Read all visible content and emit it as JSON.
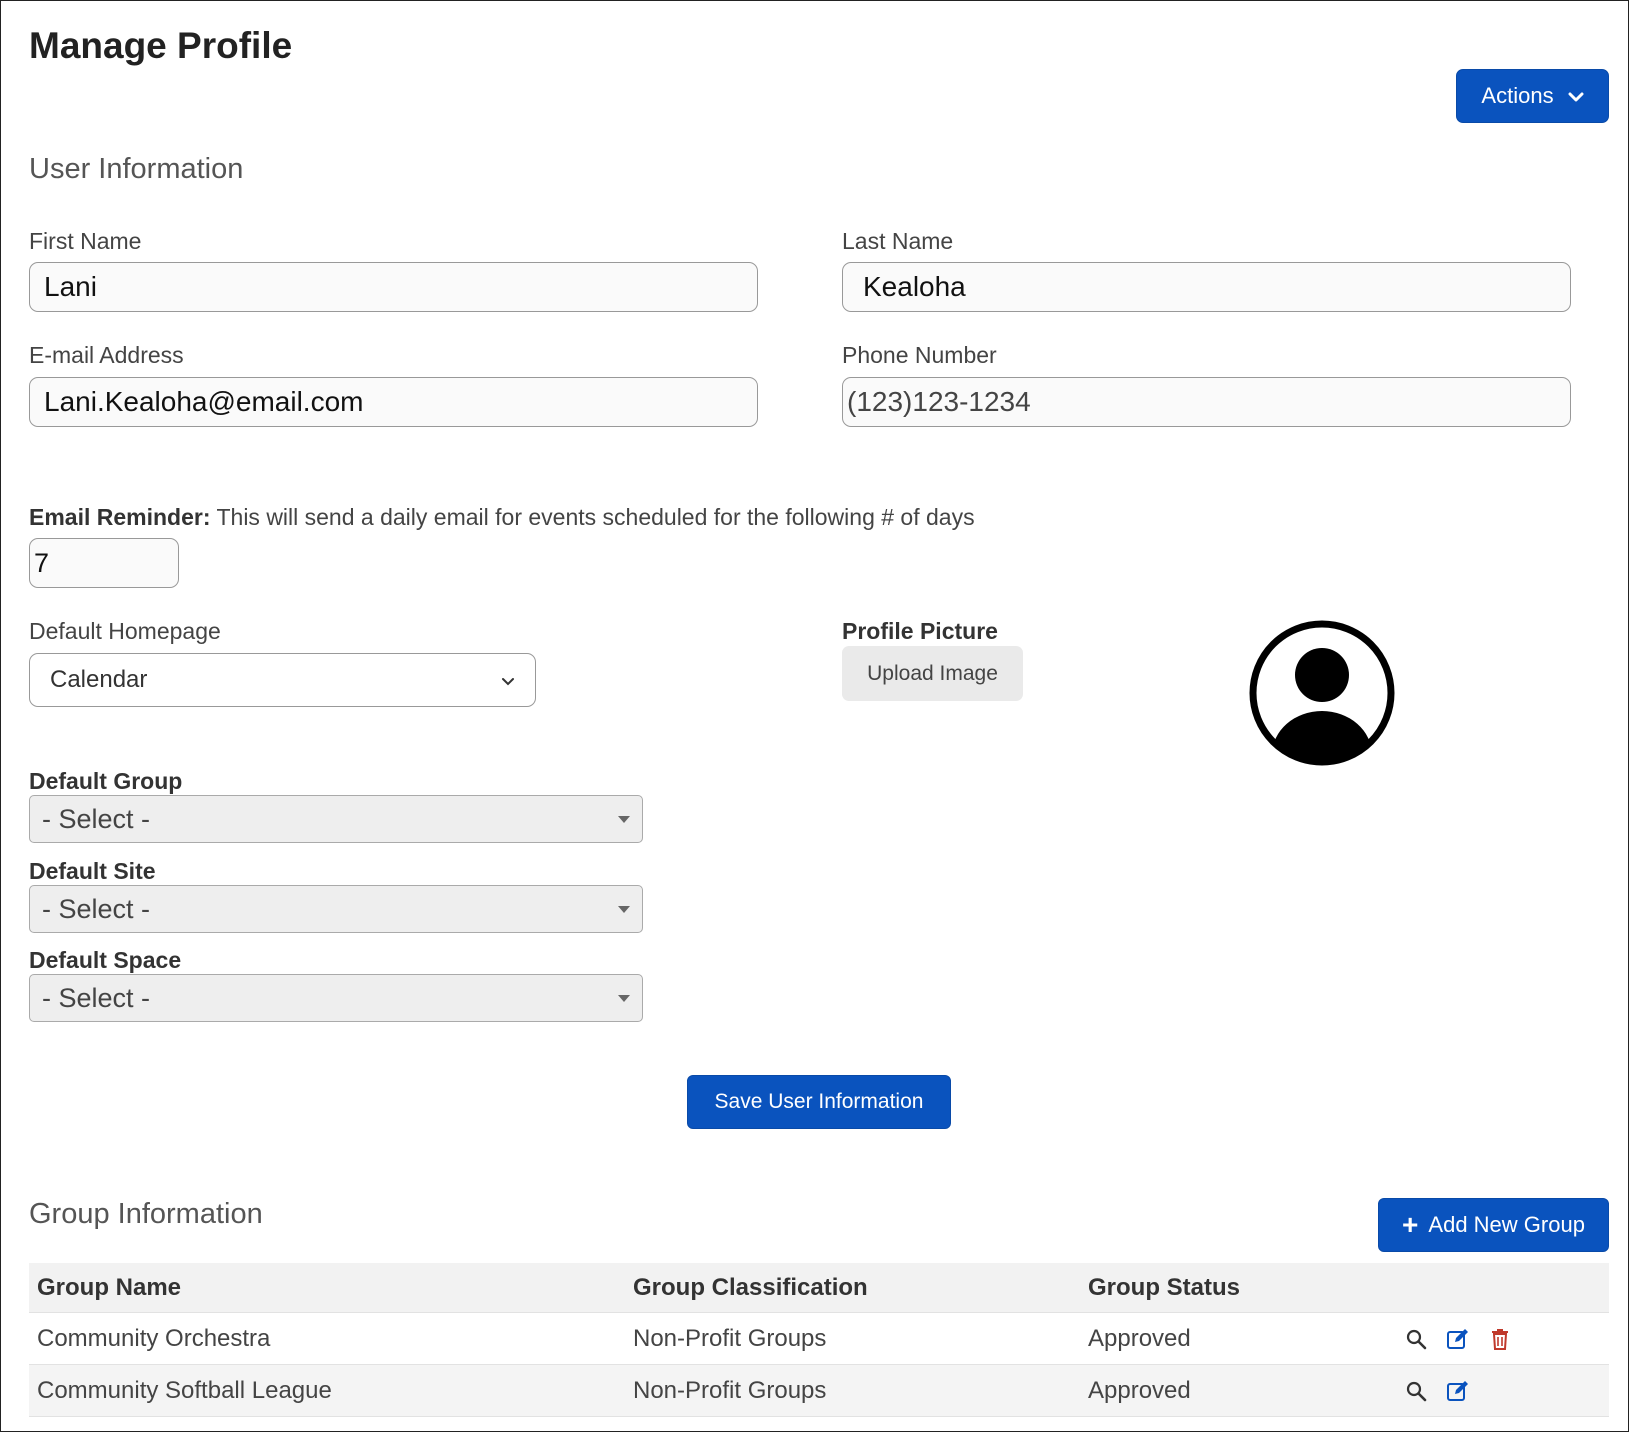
{
  "page": {
    "title": "Manage Profile"
  },
  "actions": {
    "label": "Actions"
  },
  "user_info": {
    "section_title": "User Information",
    "first_name": {
      "label": "First Name",
      "value": "Lani"
    },
    "last_name": {
      "label": "Last Name",
      "value": "Kealoha"
    },
    "email": {
      "label": "E-mail Address",
      "value": "Lani.Kealoha@email.com"
    },
    "phone": {
      "label": "Phone Number",
      "value": "(123)123-1234"
    },
    "email_reminder": {
      "label": "Email Reminder:",
      "description": " This will send a daily email for events scheduled for the following # of days",
      "value": "7"
    },
    "default_homepage": {
      "label": "Default Homepage",
      "value": "Calendar"
    },
    "profile_picture": {
      "label": "Profile Picture",
      "upload_label": "Upload Image",
      "icon": "user-circle-icon"
    },
    "default_group": {
      "label": "Default Group",
      "value": "- Select -"
    },
    "default_site": {
      "label": "Default Site",
      "value": "- Select -"
    },
    "default_space": {
      "label": "Default Space",
      "value": "- Select -"
    },
    "save_label": "Save User Information"
  },
  "group_info": {
    "section_title": "Group Information",
    "add_label": "Add New Group",
    "columns": [
      "Group Name",
      "Group Classification",
      "Group Status"
    ],
    "rows": [
      {
        "name": "Community Orchestra",
        "classification": "Non-Profit Groups",
        "status": "Approved",
        "actions": [
          "search-icon",
          "edit-icon",
          "delete-icon"
        ]
      },
      {
        "name": "Community Softball League",
        "classification": "Non-Profit Groups",
        "status": "Approved",
        "actions": [
          "search-icon",
          "edit-icon"
        ]
      }
    ]
  },
  "colors": {
    "primary": "#0a53be",
    "delete": "#c0392b"
  }
}
